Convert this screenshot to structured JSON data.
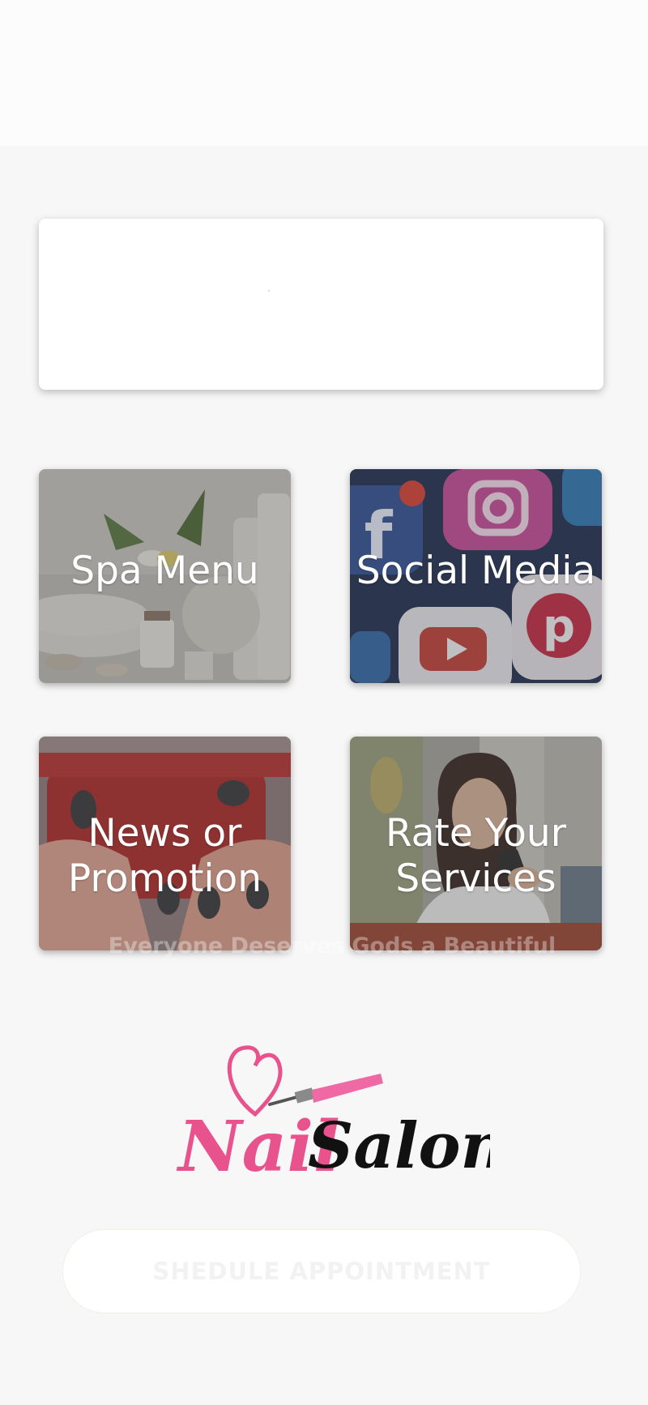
{
  "banner": {},
  "tiles": [
    {
      "label": "Spa Menu"
    },
    {
      "label": "Social Media"
    },
    {
      "label": "News or\nPromotion"
    },
    {
      "label": "Rate Your\nServices"
    }
  ],
  "overlay_text": "Everyone Deserves Gods a Beautiful",
  "logo": {
    "word1": "Nail",
    "word2": "Salon",
    "accent_color": "#e8538e"
  },
  "appointment_button": {
    "label": "SHEDULE APPOINTMENT"
  },
  "colors": {
    "background": "#f7f7f7",
    "tile_text": "#ffffff",
    "logo_pink": "#e8538e",
    "logo_black": "#111111"
  }
}
